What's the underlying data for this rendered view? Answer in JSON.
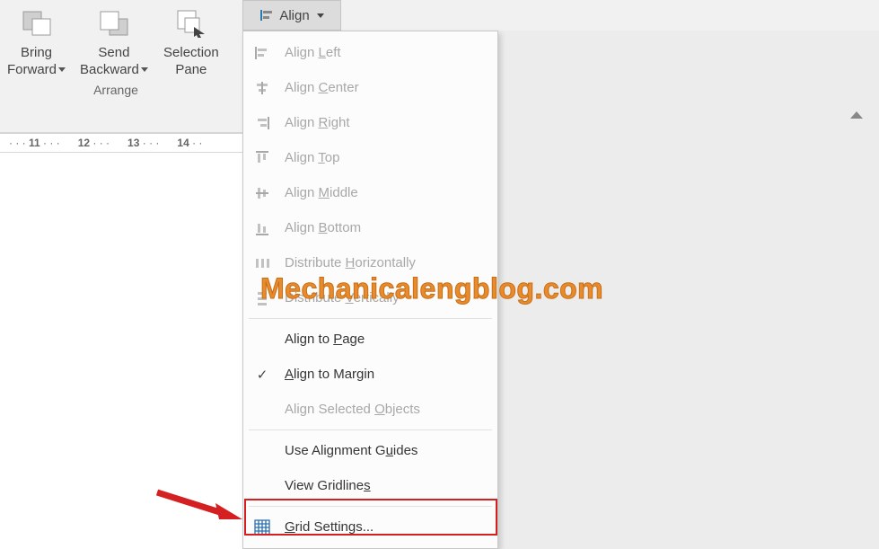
{
  "ribbon": {
    "bring_forward": "Bring\nForward",
    "send_backward": "Send\nBackward",
    "selection_pane": "Selection\nPane",
    "group_label": "Arrange",
    "align_label": "Align"
  },
  "ruler_marks": [
    "11",
    "12",
    "13",
    "14"
  ],
  "menu": {
    "items": [
      {
        "label": "Align Left",
        "underline": "L",
        "enabled": false,
        "icon": "align-left-icon"
      },
      {
        "label": "Align Center",
        "underline": "C",
        "enabled": false,
        "icon": "align-center-icon"
      },
      {
        "label": "Align Right",
        "underline": "R",
        "enabled": false,
        "icon": "align-right-icon"
      },
      {
        "label": "Align Top",
        "underline": "T",
        "enabled": false,
        "icon": "align-top-icon"
      },
      {
        "label": "Align Middle",
        "underline": "M",
        "enabled": false,
        "icon": "align-middle-icon"
      },
      {
        "label": "Align Bottom",
        "underline": "B",
        "enabled": false,
        "icon": "align-bottom-icon"
      },
      {
        "label": "Distribute Horizontally",
        "underline": "H",
        "enabled": false,
        "icon": "distribute-h-icon"
      },
      {
        "label": "Distribute Vertically",
        "underline": "V",
        "enabled": false,
        "icon": "distribute-v-icon"
      },
      {
        "separator": true
      },
      {
        "label": "Align to Page",
        "underline": "P",
        "enabled": true,
        "icon": ""
      },
      {
        "label": "Align to Margin",
        "underline": "A",
        "enabled": true,
        "icon": "check",
        "checked": true
      },
      {
        "label": "Align Selected Objects",
        "underline": "O",
        "enabled": false,
        "icon": ""
      },
      {
        "separator": true
      },
      {
        "label": "Use Alignment Guides",
        "underline": "u",
        "enabled": true,
        "icon": ""
      },
      {
        "label": "View Gridlines",
        "underline": "s",
        "enabled": true,
        "icon": ""
      },
      {
        "separator": true
      },
      {
        "label": "Grid Settings...",
        "underline": "G",
        "enabled": true,
        "icon": "grid-icon"
      }
    ]
  },
  "watermark": "Mechanicalengblog.com"
}
